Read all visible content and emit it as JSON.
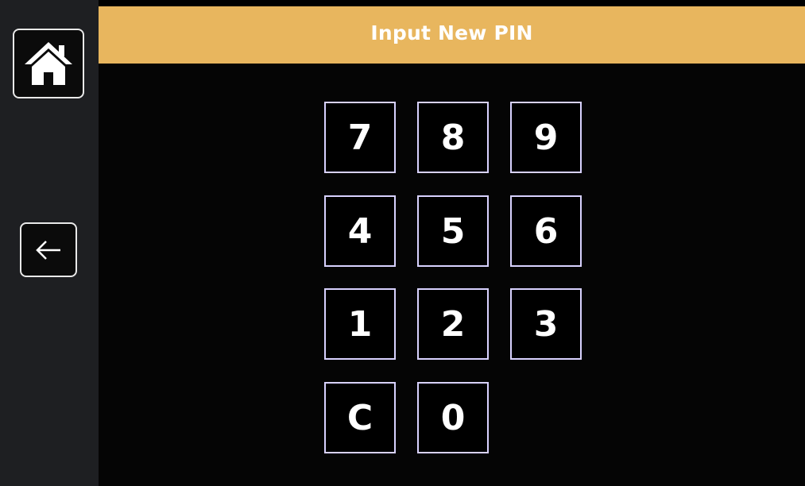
{
  "header": {
    "title": "Input New PIN"
  },
  "sidebar": {
    "home_icon": "home-icon",
    "back_icon": "arrow-left-icon"
  },
  "keypad": {
    "row1": [
      "7",
      "8",
      "9"
    ],
    "row2": [
      "4",
      "5",
      "6"
    ],
    "row3": [
      "1",
      "2",
      "3"
    ],
    "row4": [
      "C",
      "0"
    ]
  },
  "colors": {
    "header_bg": "#e8b65e",
    "sidebar_bg": "#1e1f22",
    "screen_bg": "#050505",
    "key_border": "#d8d2ff",
    "text": "#ffffff"
  }
}
